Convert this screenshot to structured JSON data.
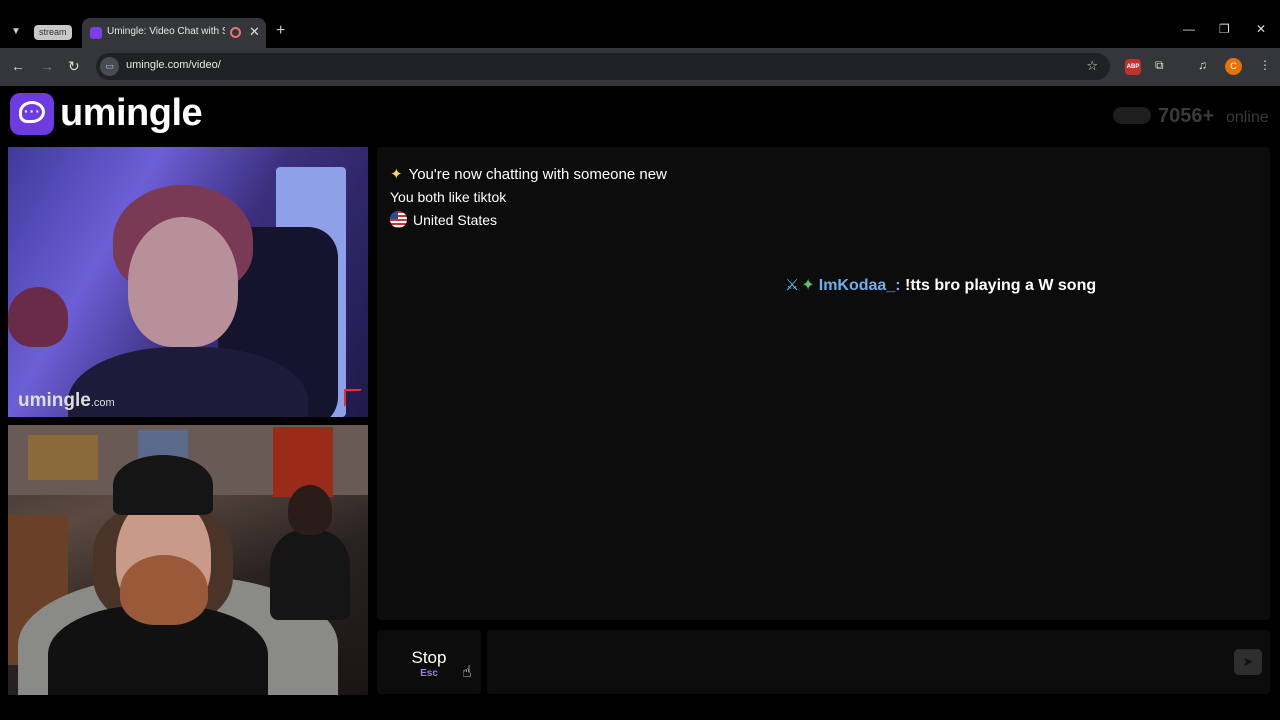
{
  "browser": {
    "tab_group_label": "stream",
    "tab_title": "Umingle: Video Chat with Strangers",
    "url": "umingle.com/video/",
    "profile_initial": "C",
    "abp_label": "ABP"
  },
  "header": {
    "logo_text": "umingle",
    "online_count": "7056+",
    "online_label": "online"
  },
  "videos": {
    "stranger_watermark": "umingle",
    "stranger_watermark_suffix": ".com"
  },
  "chat": {
    "system_message": "You're now chatting with someone new",
    "common_interest": "You both like tiktok",
    "country": "United States"
  },
  "overlay_message": {
    "username": "ImKodaa_:",
    "text": "!tts bro playing a W song"
  },
  "controls": {
    "stop_label": "Stop",
    "stop_shortcut": "Esc",
    "message_placeholder": ""
  },
  "icons": {
    "sparkle": "sparkle-icon",
    "send": "send-icon"
  }
}
